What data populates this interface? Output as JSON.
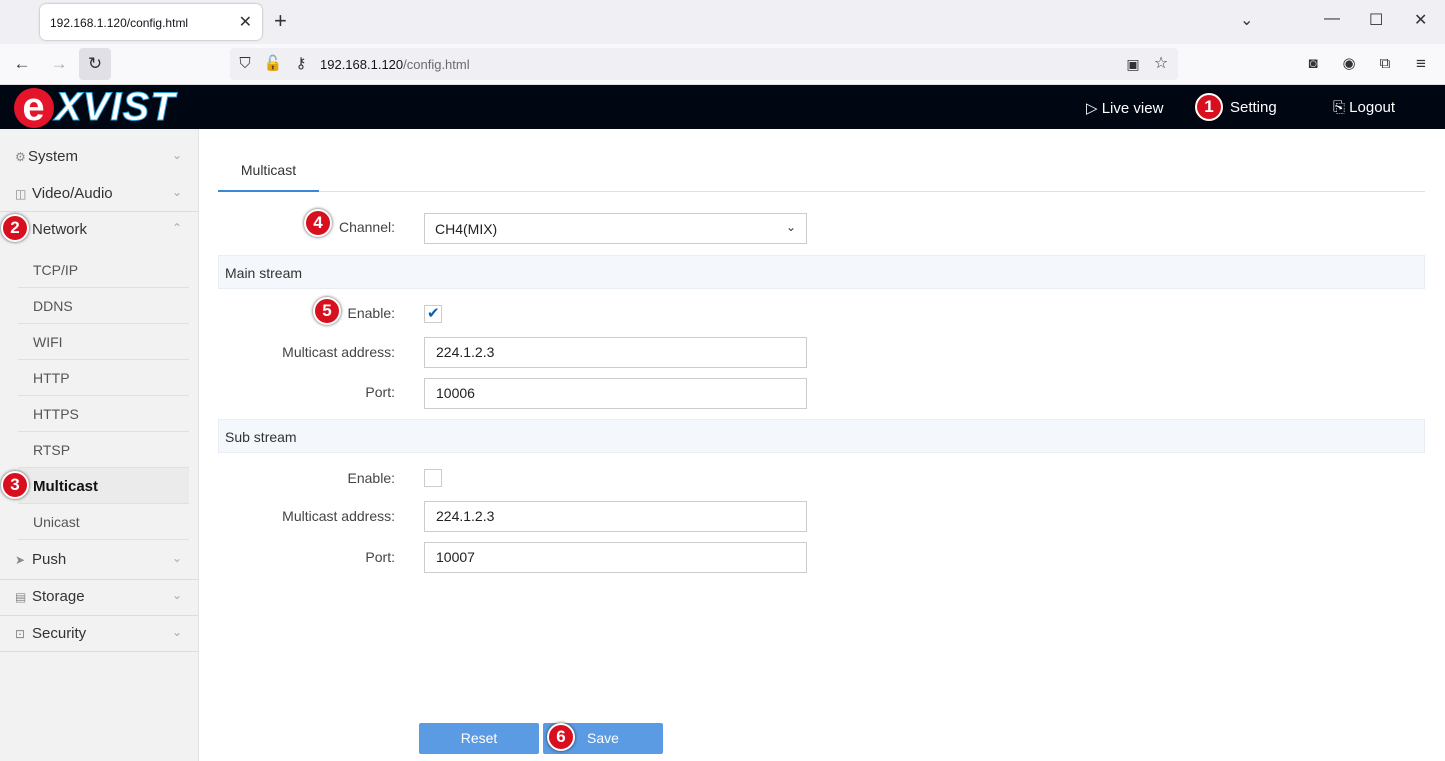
{
  "browser": {
    "tab_title": "192.168.1.120/config.html",
    "tab_close": "✕",
    "new_tab": "+",
    "url_host": "192.168.1.120",
    "url_path": "/config.html",
    "window_controls": [
      "⌄",
      "—",
      "☐",
      "✕"
    ]
  },
  "header": {
    "logo_e": "e",
    "logo_rest": "XVIST",
    "live_view": "Live view",
    "setting": "Setting",
    "logout": "Logout"
  },
  "sidebar": {
    "items": [
      {
        "label": "System",
        "icon": "gear-icon"
      },
      {
        "label": "Video/Audio",
        "icon": "camera-icon"
      },
      {
        "label": "Network",
        "icon": "network-icon"
      },
      {
        "label": "Push",
        "icon": "send-icon"
      },
      {
        "label": "Storage",
        "icon": "disk-icon"
      },
      {
        "label": "Security",
        "icon": "lock-icon"
      }
    ],
    "network_sub": [
      "TCP/IP",
      "DDNS",
      "WIFI",
      "HTTP",
      "HTTPS",
      "RTSP",
      "Multicast",
      "Unicast"
    ],
    "active_sub": "Multicast"
  },
  "main": {
    "tab": "Multicast",
    "channel_label": "Channel:",
    "channel_value": "CH4(MIX)",
    "main_stream": {
      "title": "Main stream",
      "enable_label": "Enable:",
      "enabled": true,
      "address_label": "Multicast address:",
      "address": "224.1.2.3",
      "port_label": "Port:",
      "port": "10006"
    },
    "sub_stream": {
      "title": "Sub stream",
      "enable_label": "Enable:",
      "enabled": false,
      "address_label": "Multicast address:",
      "address": "224.1.2.3",
      "port_label": "Port:",
      "port": "10007"
    },
    "reset": "Reset",
    "save": "Save"
  },
  "badges": [
    "1",
    "2",
    "3",
    "4",
    "5",
    "6"
  ],
  "colors": {
    "accent": "#3b86d6",
    "button": "#5b9be3",
    "badge": "#d80f1e",
    "header": "#000612"
  }
}
